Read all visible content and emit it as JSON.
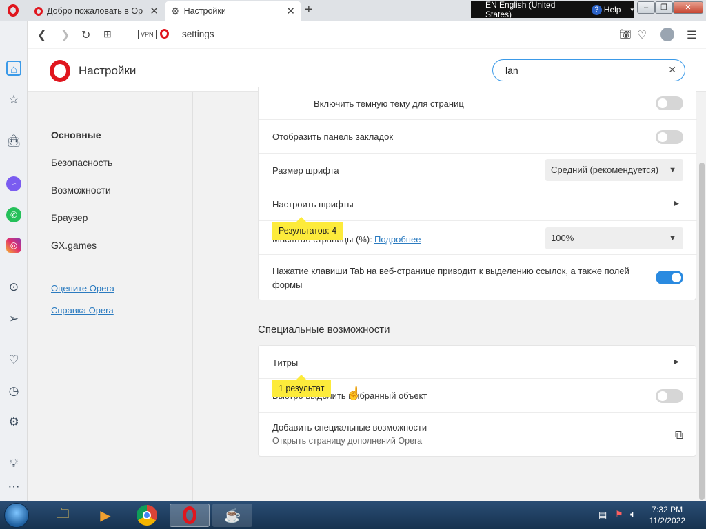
{
  "browser": {
    "tabs": [
      {
        "title": "Добро пожаловать в Opera"
      },
      {
        "title": "Настройки"
      }
    ],
    "new_tab": "+",
    "address": "settings",
    "vpn_label": "VPN",
    "language_bar": {
      "lang": "EN English (United States)",
      "help": "Help"
    }
  },
  "settings": {
    "title": "Настройки",
    "search_value": "lan",
    "nav": [
      "Основные",
      "Безопасность",
      "Возможности",
      "Браузер",
      "GX.games"
    ],
    "links": [
      "Оцените Opera",
      "Справка Opera"
    ],
    "appearance_rows": {
      "dark_pages": "Включить темную тему для страниц",
      "bookmarks_bar": "Отобразить панель закладок",
      "font_size": "Размер шрифта",
      "font_size_value": "Средний (рекомендуется)",
      "customize_fonts": "Настроить шрифты",
      "zoom": "Масштаб страницы (%):",
      "zoom_link": "Подробнее",
      "zoom_value": "100%",
      "tab_highlight": "Нажатие клавиши Tab на веб-странице приводит к выделению ссылок, а также полей формы"
    },
    "toggles": {
      "dark_pages": false,
      "bookmarks_bar": false,
      "tab_highlight": true
    },
    "badges": {
      "results_4": "Результатов: 4",
      "result_1": "1 результат"
    },
    "accessibility": {
      "heading": "Специальные возможности",
      "captions": "Титры",
      "quick_highlight": "Быстро выделить выбранный объект",
      "add_features": "Добавить специальные возможности",
      "add_features_sub": "Открыть страницу дополнений Opera"
    },
    "toggles_access": {
      "quick_highlight": false
    }
  },
  "taskbar": {
    "time": "7:32 PM",
    "date": "11/2/2022"
  },
  "colors": {
    "accent": "#2a8ae0",
    "opera_red": "#e0161e",
    "badge": "#fdeb3b"
  }
}
